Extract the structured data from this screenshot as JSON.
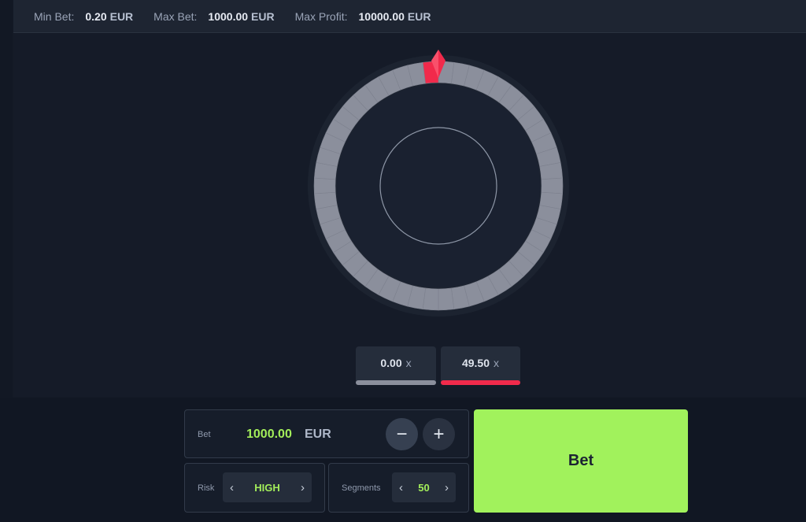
{
  "limits": {
    "min_bet_label": "Min Bet:",
    "min_bet_value": "0.20",
    "min_bet_unit": "EUR",
    "max_bet_label": "Max Bet:",
    "max_bet_value": "1000.00",
    "max_bet_unit": "EUR",
    "max_profit_label": "Max Profit:",
    "max_profit_value": "10000.00",
    "max_profit_unit": "EUR"
  },
  "wheel": {
    "segments": 50,
    "winning_segment_index": 49,
    "segment_color": "#8b8f9c",
    "winning_color": "#f12a4b",
    "pointer_color": "#f12a4b",
    "pointer_icon": "pointer-gem-icon"
  },
  "multipliers": [
    {
      "value": "0.00",
      "unit": "x",
      "color": "#8b8f9c"
    },
    {
      "value": "49.50",
      "unit": "x",
      "color": "#f12a4b"
    }
  ],
  "bet": {
    "label": "Bet",
    "amount": "1000.00",
    "currency": "EUR",
    "decrease_icon": "minus-icon",
    "decrease_symbol": "−",
    "increase_icon": "plus-icon",
    "increase_symbol": "+"
  },
  "risk": {
    "label": "Risk",
    "value": "HIGH",
    "prev": "‹",
    "next": "›"
  },
  "segments_ctrl": {
    "label": "Segments",
    "value": "50",
    "prev": "‹",
    "next": "›"
  },
  "bet_button": {
    "label": "Bet",
    "color": "#a1f25c"
  }
}
